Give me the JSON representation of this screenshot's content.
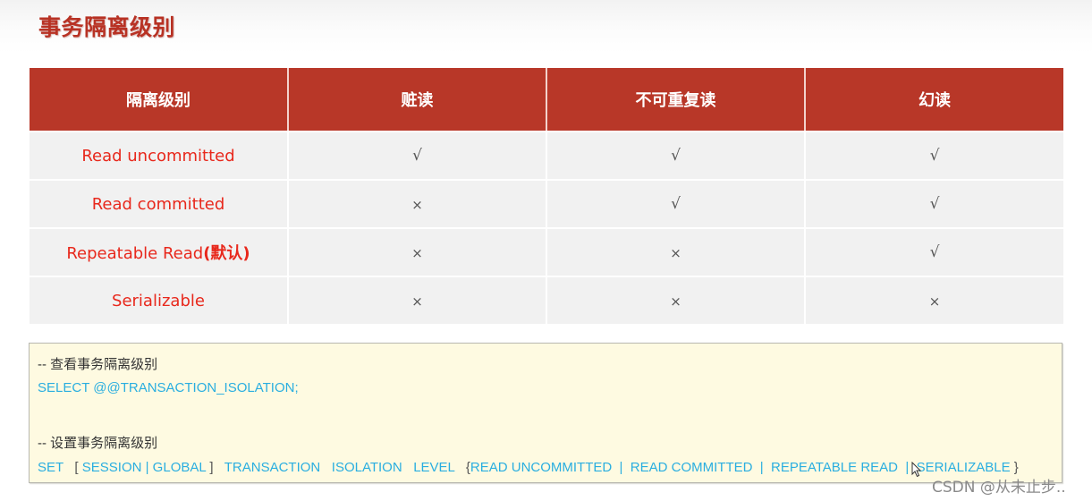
{
  "page": {
    "title": "事务隔离级别"
  },
  "table": {
    "headers": [
      "隔离级别",
      "赃读",
      "不可重复读",
      "幻读"
    ],
    "rows": [
      {
        "level": "Read uncommitted",
        "note": "",
        "dirty_read": "√",
        "non_repeatable_read": "√",
        "phantom_read": "√"
      },
      {
        "level": "Read committed",
        "note": "",
        "dirty_read": "×",
        "non_repeatable_read": "√",
        "phantom_read": "√"
      },
      {
        "level": "Repeatable Read",
        "note": "(默认)",
        "dirty_read": "×",
        "non_repeatable_read": "×",
        "phantom_read": "√"
      },
      {
        "level": "Serializable",
        "note": "",
        "dirty_read": "×",
        "non_repeatable_read": "×",
        "phantom_read": "×"
      }
    ]
  },
  "code": {
    "comment_view": "-- 查看事务隔离级别",
    "select_stmt": "SELECT @@TRANSACTION_ISOLATION;",
    "comment_set": "-- 设置事务隔离级别",
    "set_stmt": {
      "set": "SET",
      "open_bracket": "[",
      "scope_options": "SESSION | GLOBAL",
      "close_bracket": "]",
      "transaction": "TRANSACTION",
      "isolation": "ISOLATION",
      "level": "LEVEL",
      "open_brace": "{",
      "level_options": "READ UNCOMMITTED  |  READ COMMITTED  |  REPEATABLE READ  |  SERIALIZABLE",
      "close_brace": "}"
    }
  },
  "watermark": "CSDN @从未止步..",
  "colors": {
    "title": "#b83224",
    "header_bg": "#b83728",
    "level_text": "#e8281c",
    "code_keyword": "#2aaee0",
    "code_bg": "#fefae1"
  }
}
